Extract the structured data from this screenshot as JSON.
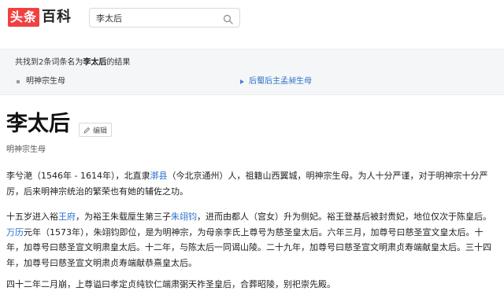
{
  "header": {
    "logo_part1": "头条",
    "logo_part2": "百科",
    "search": {
      "value": "李太后",
      "placeholder": ""
    },
    "search_icon": "search-icon"
  },
  "results": {
    "summary_prefix": "共找到2条词条名为",
    "summary_term": "李太后",
    "summary_suffix": "的结果",
    "items": [
      {
        "label": "明神宗生母"
      },
      {
        "label": "后蜀后主孟昶生母"
      }
    ]
  },
  "entry": {
    "title": "李太后",
    "edit_label": "编辑",
    "subtitle": "明神宗生母",
    "p1": {
      "t1": "李兮滟（1546年 - 1614年），北直隶",
      "l1": "漷县",
      "t2": "（今北京通州）人，祖籍山西翼城，明神宗生母。为人十分严谨，对于明神宗十分严厉，后来明神宗统治的繁荣也有她的辅佐之功。"
    },
    "p2": {
      "t1": "十五岁进入裕",
      "l1": "王府",
      "t2": "，为裕王朱载垕生第三子",
      "l2": "朱翊钧",
      "t3": "，进而由都人（宫女）升为侧妃。裕王登基后被封贵妃，地位仅次于陈皇后。",
      "l3": "万历",
      "t4": "元年（1573年），朱翊钧即位，是为明神宗，为母亲李氏上尊号为慈圣皇太后。六年三月，加尊号曰慈圣宣文皇太后。十年，加尊号曰慈圣宣文明肃皇太后。十二年，与陈太后一同谒山陵。二十九年，加尊号曰慈圣宣文明肃贞寿端献皇太后。三十四年，加尊号曰慈圣宣文明肃贞寿端献恭熹皇太后。"
    },
    "p3": {
      "t1": "四十二年二月崩，上尊谥曰孝定贞纯钦仁端肃弼天祚圣皇后，合葬昭陵，别祀崇先殿。"
    }
  },
  "colors": {
    "brand_red": "#f04142",
    "link_blue": "#2a6fc9"
  }
}
